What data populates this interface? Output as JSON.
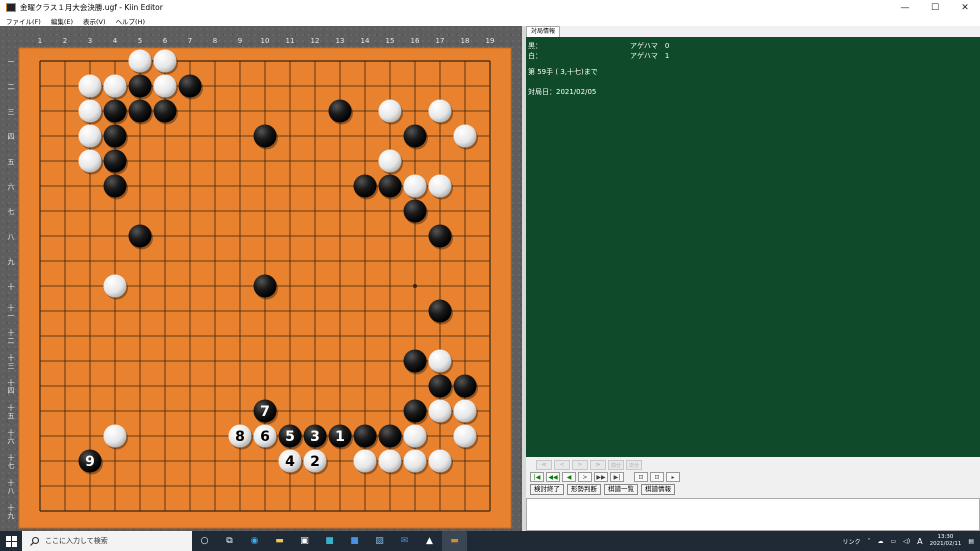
{
  "window": {
    "title": "金曜クラス１月大会決勝.ugf - Kiin Editor",
    "controls": [
      "—",
      "☐",
      "✕"
    ]
  },
  "menu": [
    "ファイル(F)",
    "編集(E)",
    "表示(V)",
    "ヘルプ(H)"
  ],
  "board": {
    "size": 19,
    "col_labels": [
      "1",
      "2",
      "3",
      "4",
      "5",
      "6",
      "7",
      "8",
      "9",
      "10",
      "11",
      "12",
      "13",
      "14",
      "15",
      "16",
      "17",
      "18",
      "19"
    ],
    "row_labels": [
      "一",
      "二",
      "三",
      "四",
      "五",
      "六",
      "七",
      "八",
      "九",
      "十",
      "十一",
      "十二",
      "十三",
      "十四",
      "十五",
      "十六",
      "十七",
      "十八",
      "十九"
    ],
    "stones": [
      {
        "c": "w",
        "x": 5,
        "y": 1
      },
      {
        "c": "w",
        "x": 6,
        "y": 1
      },
      {
        "c": "w",
        "x": 3,
        "y": 2
      },
      {
        "c": "w",
        "x": 4,
        "y": 2
      },
      {
        "c": "b",
        "x": 5,
        "y": 2
      },
      {
        "c": "w",
        "x": 6,
        "y": 2
      },
      {
        "c": "b",
        "x": 7,
        "y": 2
      },
      {
        "c": "w",
        "x": 3,
        "y": 3
      },
      {
        "c": "b",
        "x": 4,
        "y": 3
      },
      {
        "c": "b",
        "x": 5,
        "y": 3
      },
      {
        "c": "b",
        "x": 6,
        "y": 3
      },
      {
        "c": "b",
        "x": 13,
        "y": 3
      },
      {
        "c": "w",
        "x": 15,
        "y": 3
      },
      {
        "c": "w",
        "x": 17,
        "y": 3
      },
      {
        "c": "w",
        "x": 3,
        "y": 4
      },
      {
        "c": "b",
        "x": 4,
        "y": 4
      },
      {
        "c": "b",
        "x": 10,
        "y": 4
      },
      {
        "c": "b",
        "x": 16,
        "y": 4
      },
      {
        "c": "w",
        "x": 18,
        "y": 4
      },
      {
        "c": "w",
        "x": 3,
        "y": 5
      },
      {
        "c": "b",
        "x": 4,
        "y": 5
      },
      {
        "c": "w",
        "x": 15,
        "y": 5
      },
      {
        "c": "b",
        "x": 4,
        "y": 6
      },
      {
        "c": "b",
        "x": 14,
        "y": 6
      },
      {
        "c": "b",
        "x": 15,
        "y": 6
      },
      {
        "c": "w",
        "x": 16,
        "y": 6
      },
      {
        "c": "w",
        "x": 17,
        "y": 6
      },
      {
        "c": "b",
        "x": 16,
        "y": 7
      },
      {
        "c": "b",
        "x": 5,
        "y": 8
      },
      {
        "c": "b",
        "x": 17,
        "y": 8
      },
      {
        "c": "w",
        "x": 4,
        "y": 10
      },
      {
        "c": "b",
        "x": 10,
        "y": 10
      },
      {
        "c": "b",
        "x": 17,
        "y": 11
      },
      {
        "c": "b",
        "x": 16,
        "y": 13
      },
      {
        "c": "w",
        "x": 17,
        "y": 13
      },
      {
        "c": "b",
        "x": 17,
        "y": 14
      },
      {
        "c": "b",
        "x": 18,
        "y": 14
      },
      {
        "c": "b",
        "x": 10,
        "y": 15,
        "n": "7"
      },
      {
        "c": "b",
        "x": 16,
        "y": 15
      },
      {
        "c": "w",
        "x": 17,
        "y": 15
      },
      {
        "c": "w",
        "x": 18,
        "y": 15
      },
      {
        "c": "w",
        "x": 4,
        "y": 16
      },
      {
        "c": "w",
        "x": 9,
        "y": 16,
        "n": "8"
      },
      {
        "c": "w",
        "x": 10,
        "y": 16,
        "n": "6"
      },
      {
        "c": "b",
        "x": 11,
        "y": 16,
        "n": "5"
      },
      {
        "c": "b",
        "x": 12,
        "y": 16,
        "n": "3"
      },
      {
        "c": "b",
        "x": 13,
        "y": 16,
        "n": "1"
      },
      {
        "c": "b",
        "x": 14,
        "y": 16
      },
      {
        "c": "b",
        "x": 15,
        "y": 16
      },
      {
        "c": "w",
        "x": 16,
        "y": 16
      },
      {
        "c": "w",
        "x": 18,
        "y": 16
      },
      {
        "c": "b",
        "x": 3,
        "y": 17,
        "n": "9"
      },
      {
        "c": "w",
        "x": 11,
        "y": 17,
        "n": "4"
      },
      {
        "c": "w",
        "x": 12,
        "y": 17,
        "n": "2"
      },
      {
        "c": "w",
        "x": 14,
        "y": 17
      },
      {
        "c": "w",
        "x": 15,
        "y": 17
      },
      {
        "c": "w",
        "x": 16,
        "y": 17
      },
      {
        "c": "w",
        "x": 17,
        "y": 17
      }
    ]
  },
  "side_panel": {
    "tab_label": "対局情報",
    "black_label": "黒：",
    "black_agehama": "アゲハマ　0",
    "white_label": "白：",
    "white_agehama": "アゲハマ　1",
    "move_info": "第 59手 ( 3,十七)まで",
    "date_info": "対局日：2021/02/05",
    "nav_disabled": [
      "≪",
      "<",
      ">",
      "≫",
      "前分",
      "次分"
    ],
    "nav_active": [
      "|◀",
      "◀◀",
      "◀",
      ">",
      "▶▶",
      "▶|",
      "⊡",
      "⊡",
      "▸"
    ],
    "buttons": [
      "検討終了",
      "形勢判断",
      "棋譜一覧",
      "棋譜情報"
    ]
  },
  "taskbar": {
    "search_placeholder": "ここに入力して検索",
    "tray_link": "リンク",
    "ime": "A",
    "time": "13:30",
    "date": "2021/02/11"
  }
}
